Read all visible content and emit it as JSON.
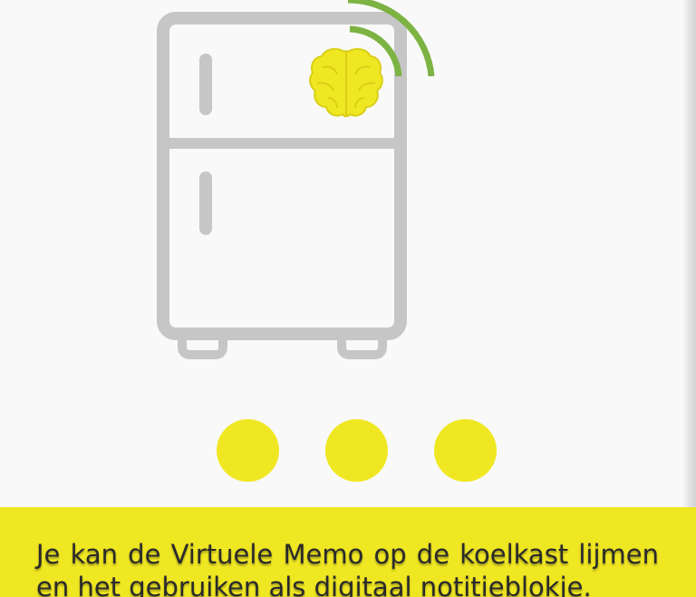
{
  "onboarding": {
    "illustration_icon": "smart-fridge-with-brain-and-signal-icon",
    "pager": {
      "page_count": 3,
      "dots": [
        {
          "label": "page-1"
        },
        {
          "label": "page-2"
        },
        {
          "label": "page-3"
        }
      ]
    },
    "caption": "Je kan de Virtuele Memo op de koelkast lijmen en het gebruiken als digitaal notitieblokje."
  },
  "colors": {
    "background": "#f9f9f9",
    "fridge_outline": "#c6c6c6",
    "brain_fill": "#f0e723",
    "brain_stroke": "#d9cf16",
    "signal": "#7cb342",
    "dot": "#f0e723",
    "panel": "#f0e723",
    "caption_text": "#2a2a2a"
  }
}
